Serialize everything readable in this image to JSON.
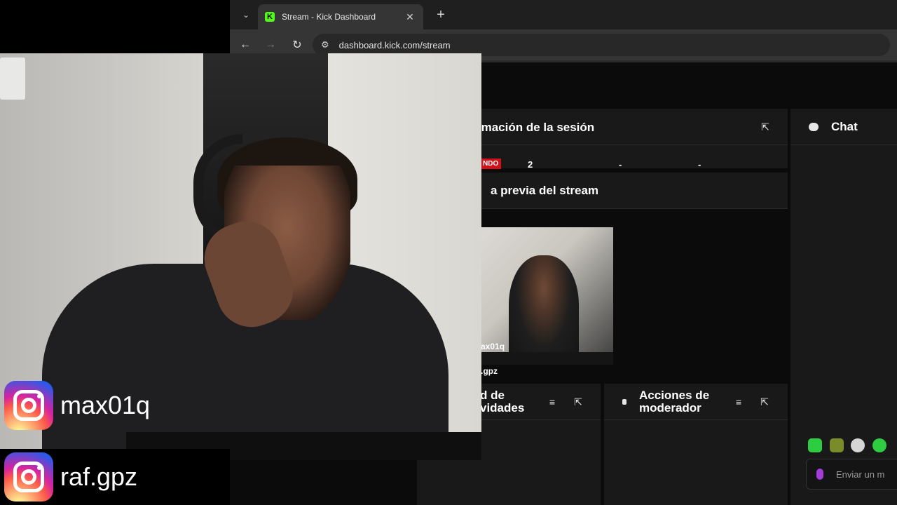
{
  "browser": {
    "tab_title": "Stream - Kick Dashboard",
    "favicon_letter": "K",
    "url": "dashboard.kick.com/stream",
    "tab_close": "✕",
    "new_tab": "+"
  },
  "dashboard": {
    "session_info": {
      "title": "rmación de la sesión",
      "live_badge": "NDO",
      "stats": [
        "2",
        "-",
        "-"
      ]
    },
    "stream_preview": {
      "title": "a previa del stream",
      "overlay_names": [
        "ax01q",
        ".gpz"
      ]
    },
    "activity_panel": {
      "title_line1": "d de",
      "title_line2": "vidades"
    },
    "mod_actions": {
      "title_line1": "Acciones de",
      "title_line2": "moderador"
    },
    "chat": {
      "title": "Chat",
      "input_placeholder": "Enviar un m"
    }
  },
  "socials": [
    {
      "platform": "instagram",
      "handle": "max01q"
    },
    {
      "platform": "instagram",
      "handle": "raf.gpz"
    }
  ],
  "colors": {
    "kick_green": "#53fc18",
    "live_red": "#d1101a",
    "panel_bg": "#191919"
  }
}
